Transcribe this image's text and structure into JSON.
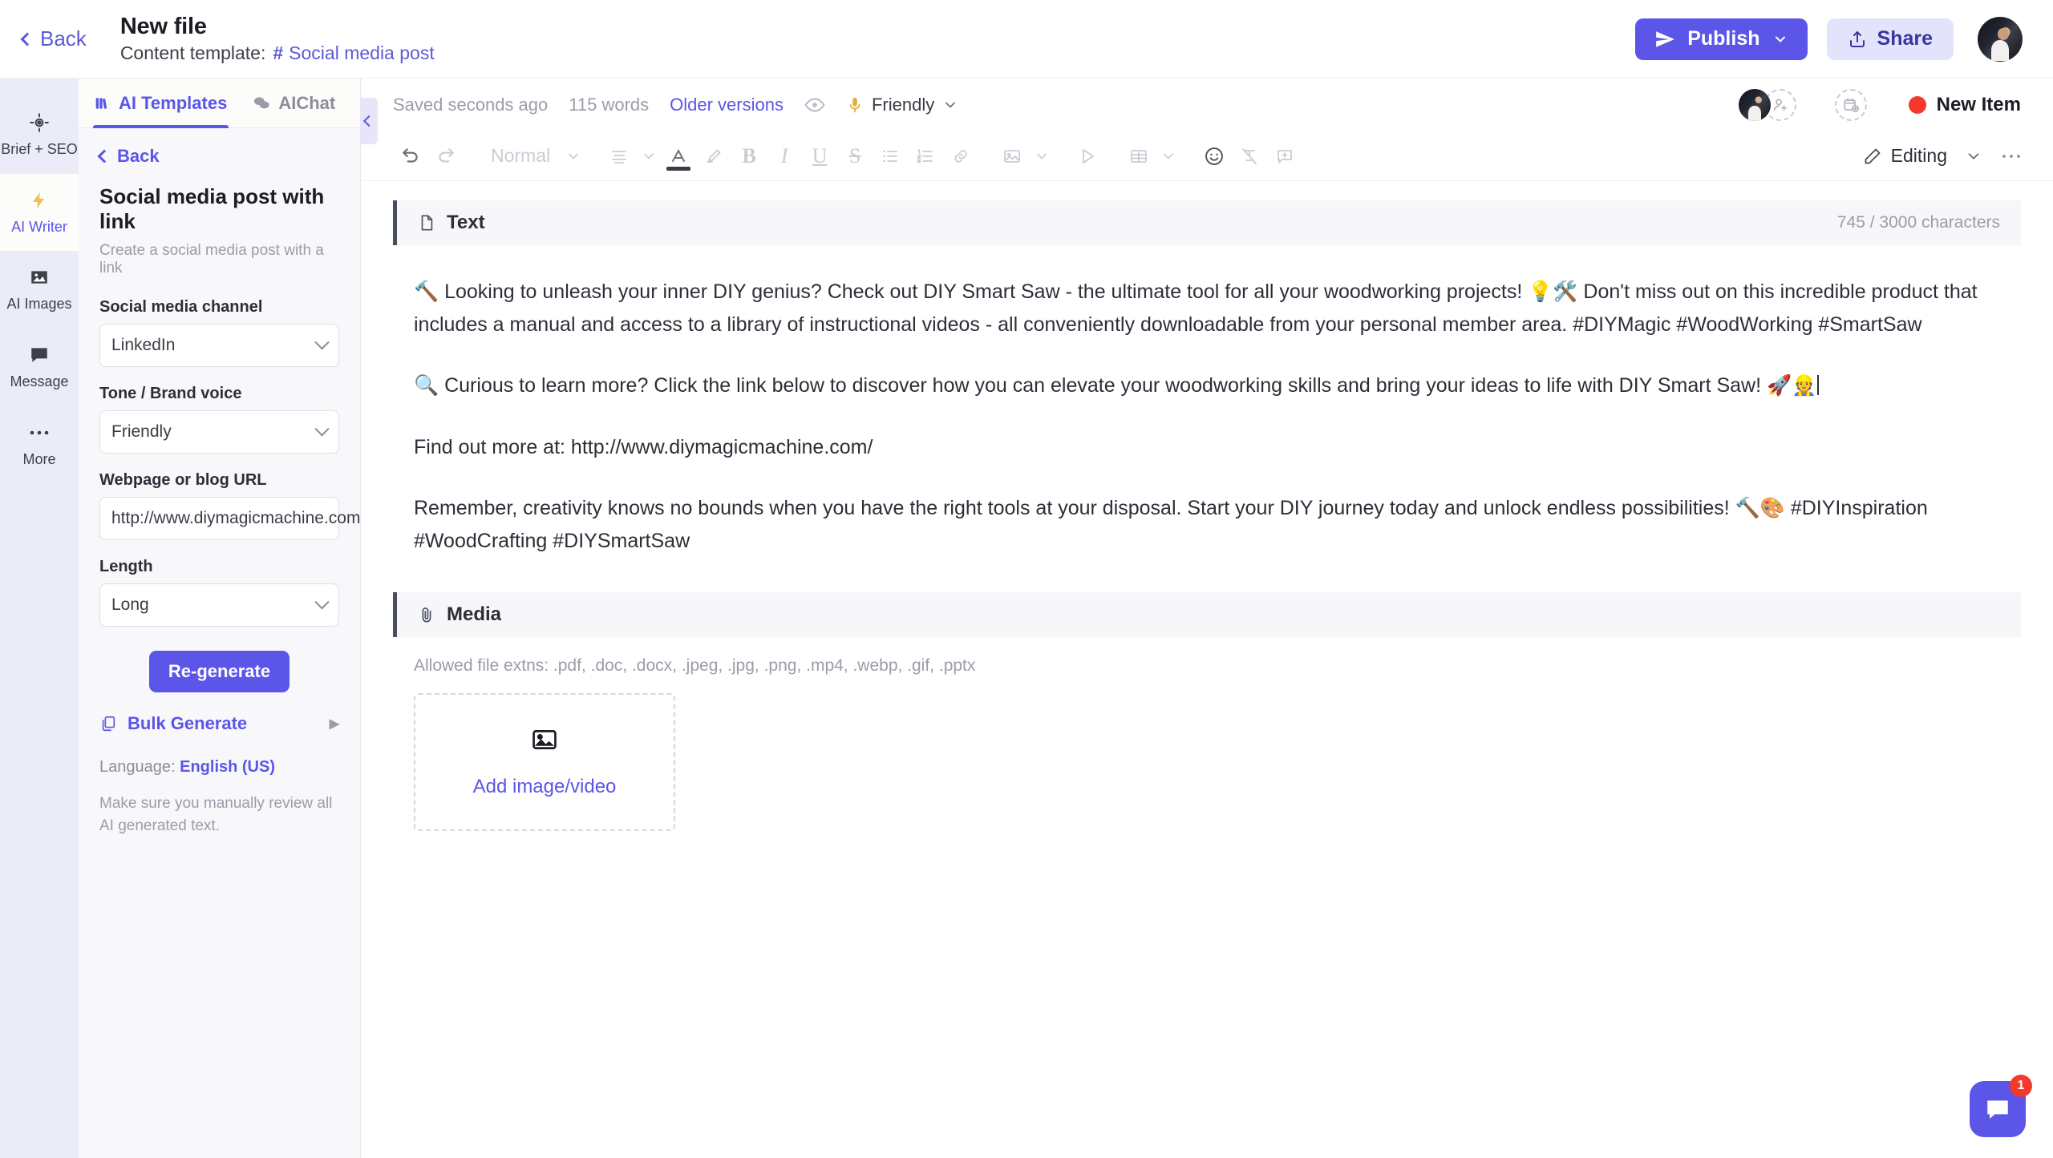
{
  "topbar": {
    "back_label": "Back",
    "file_title": "New file",
    "content_template_label": "Content template:",
    "template_name": "Social media post",
    "publish_label": "Publish",
    "share_label": "Share"
  },
  "rail": {
    "items": [
      {
        "label": "Brief + SEO",
        "icon": "target-icon"
      },
      {
        "label": "AI Writer",
        "icon": "bolt-icon"
      },
      {
        "label": "AI Images",
        "icon": "image-icon"
      },
      {
        "label": "Message",
        "icon": "chat-icon"
      },
      {
        "label": "More",
        "icon": "ellipsis-icon"
      }
    ]
  },
  "panel": {
    "tabs": [
      {
        "label": "AI Templates",
        "icon": "templates-icon"
      },
      {
        "label": "AIChat",
        "icon": "chat-bubbles-icon"
      }
    ],
    "back_label": "Back",
    "title": "Social media post with link",
    "description": "Create a social media post with a link",
    "fields": [
      {
        "label": "Social media channel",
        "value": "LinkedIn",
        "type": "select"
      },
      {
        "label": "Tone / Brand voice",
        "value": "Friendly",
        "type": "select"
      },
      {
        "label": "Webpage or blog URL",
        "value": "http://www.diymagicmachine.com/",
        "type": "text"
      },
      {
        "label": "Length",
        "value": "Long",
        "type": "select"
      }
    ],
    "regenerate_label": "Re-generate",
    "bulk_generate_label": "Bulk Generate",
    "language_prefix": "Language: ",
    "language_value": "English (US)",
    "disclaimer": "Make sure you manually review all AI generated text."
  },
  "editor": {
    "status": {
      "saved": "Saved seconds ago",
      "word_count": "115 words",
      "older_versions": "Older versions",
      "tone": "Friendly",
      "new_item": "New Item"
    },
    "toolbar": {
      "paragraph_style": "Normal",
      "editing_label": "Editing"
    },
    "text_section": {
      "title": "Text",
      "counter": "745 / 3000 characters",
      "paragraphs": [
        "🔨 Looking to unleash your inner DIY genius? Check out DIY Smart Saw - the ultimate tool for all your woodworking projects! 💡🛠️ Don't miss out on this incredible product that includes a manual and access to a library of instructional videos - all conveniently downloadable from your personal member area. #DIYMagic #WoodWorking #SmartSaw",
        "🔍 Curious to learn more? Click the link below to discover how you can elevate your woodworking skills and bring your ideas to life with DIY Smart Saw! 🚀👷",
        "Find out more at: http://www.diymagicmachine.com/",
        "Remember, creativity knows no bounds when you have the right tools at your disposal. Start your DIY journey today and unlock endless possibilities! 🔨🎨 #DIYInspiration #WoodCrafting #DIYSmartSaw"
      ]
    },
    "media_section": {
      "title": "Media",
      "allowed": "Allowed file extns: .pdf, .doc, .docx, .jpeg, .jpg, .png, .mp4, .webp, .gif, .pptx",
      "dropzone_label": "Add image/video"
    }
  },
  "chat_widget": {
    "badge": "1"
  },
  "colors": {
    "accent": "#5b55e8",
    "accent_soft": "#e3e4fb",
    "rail_bg": "#ececf8",
    "panel_bg": "#f8f8fa",
    "status_red": "#f4382a"
  }
}
